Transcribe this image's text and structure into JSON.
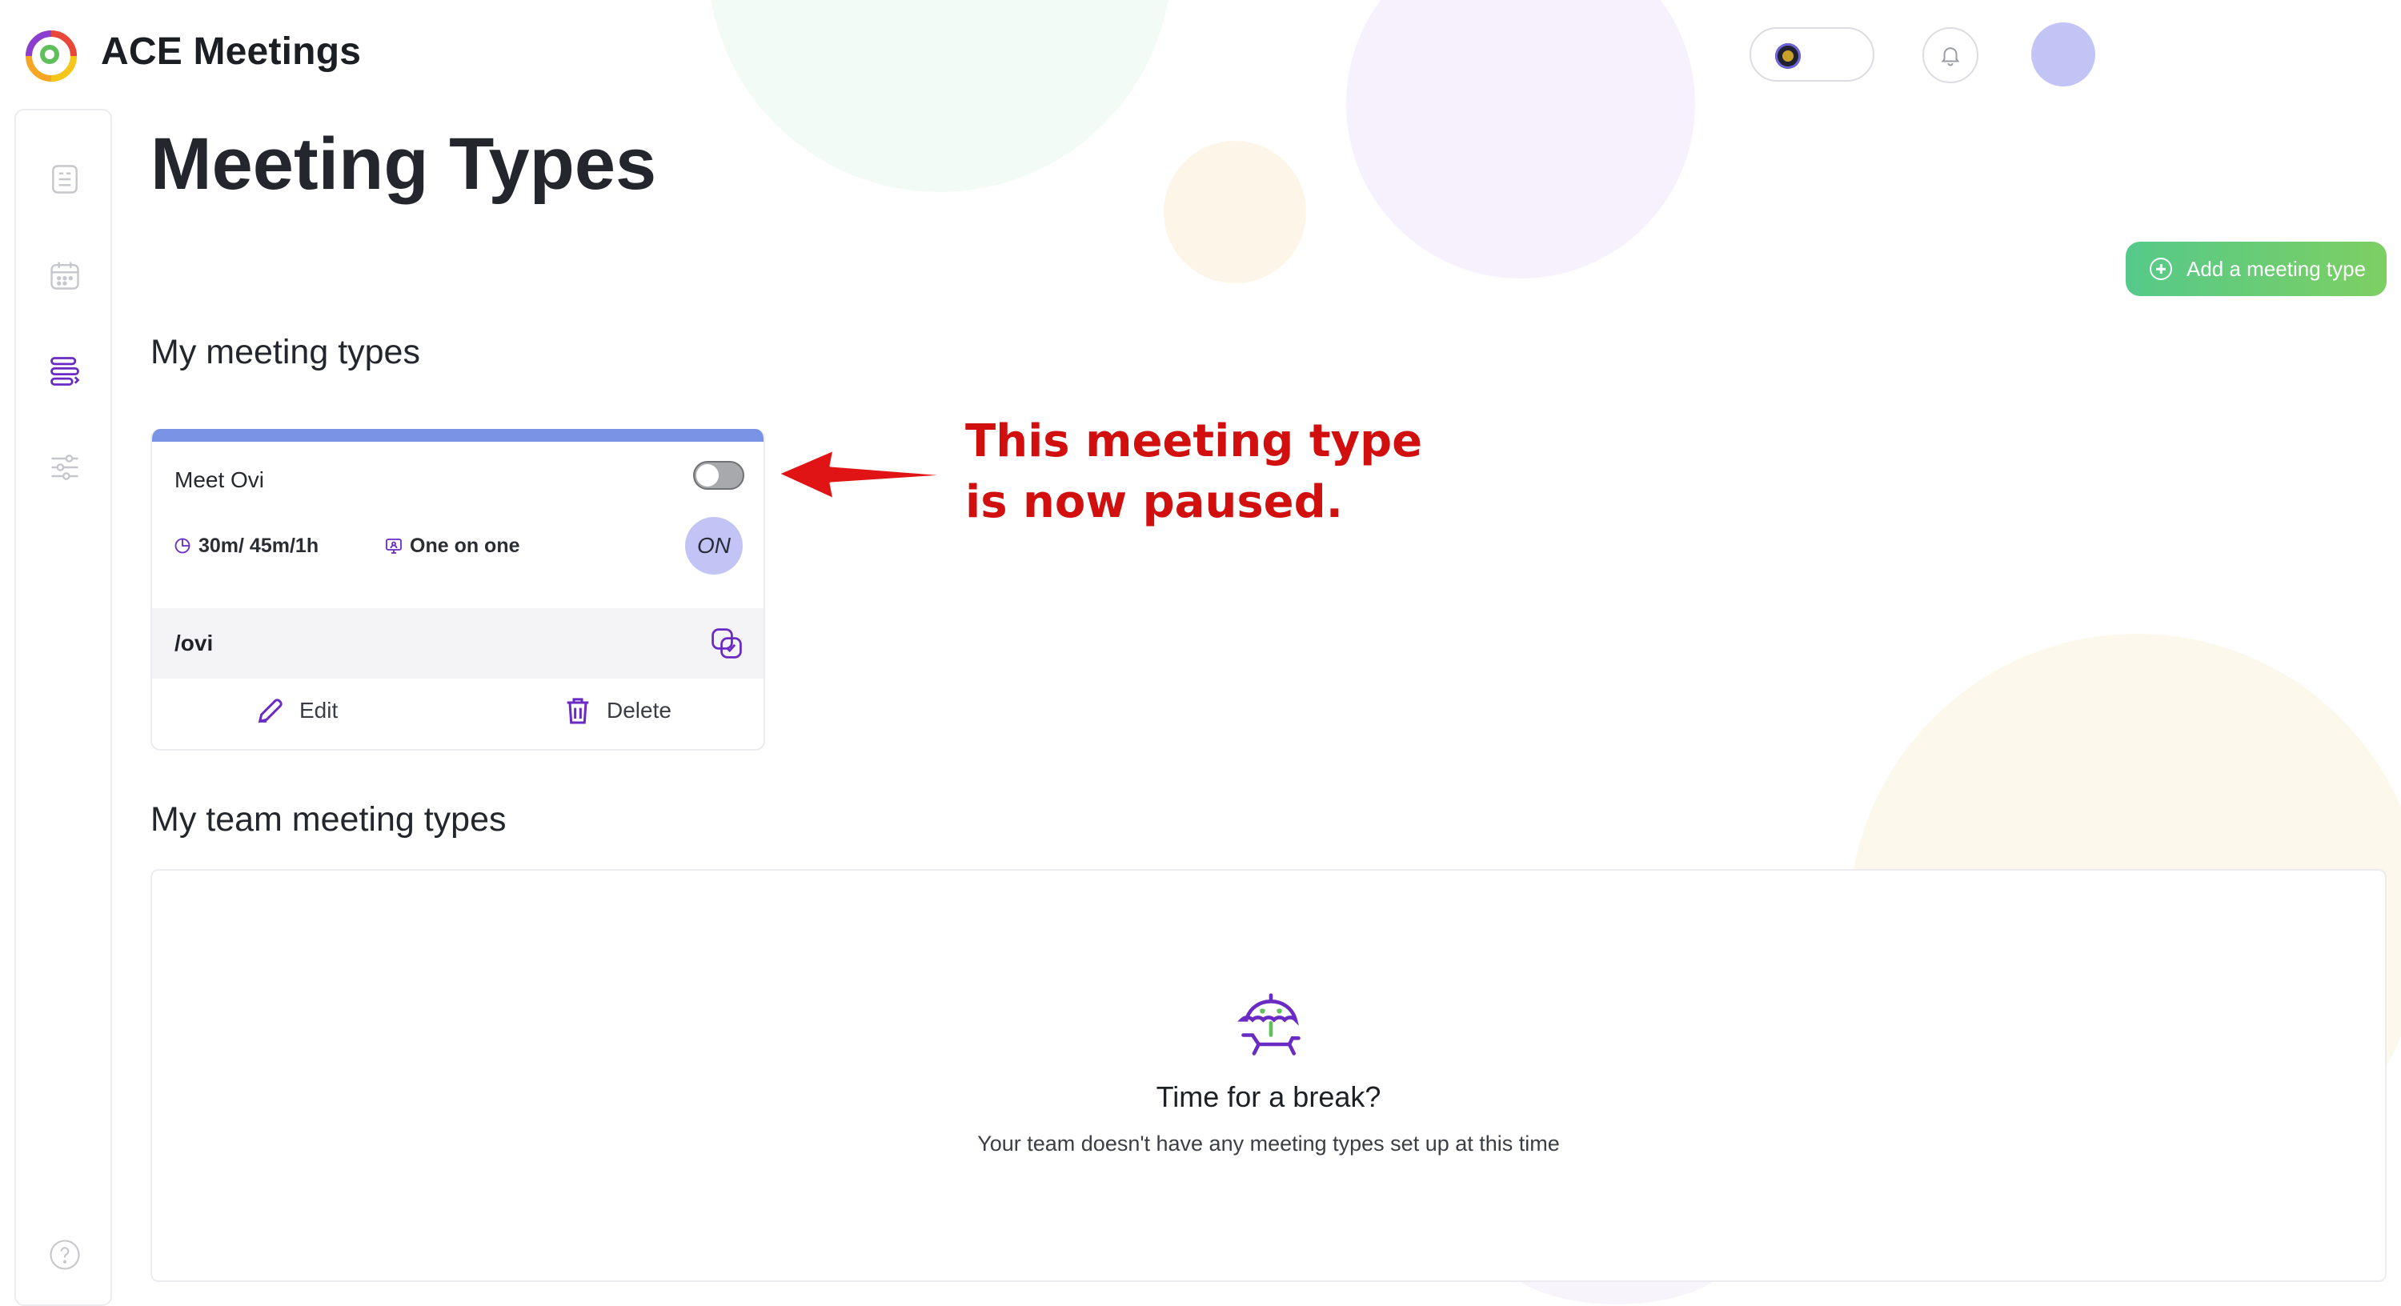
{
  "app": {
    "title": "ACE Meetings"
  },
  "page": {
    "title": "Meeting Types",
    "add_button_label": "Add a meeting type"
  },
  "sections": {
    "mine": "My meeting types",
    "team": "My team meeting types"
  },
  "meeting_card": {
    "name": "Meet Ovi",
    "paused": true,
    "durations": "30m/ 45m/1h",
    "type": "One on one",
    "badge": "ON",
    "slug": "/ovi",
    "edit_label": "Edit",
    "delete_label": "Delete",
    "accent_color": "#7a93e4"
  },
  "team_empty": {
    "title": "Time for a break?",
    "description": "Your team doesn't have any meeting types set up at this time"
  },
  "annotation": {
    "line1": "This meeting type",
    "line2": "is now paused."
  },
  "sidebar": {
    "items": [
      {
        "icon": "list-document-icon",
        "active": false
      },
      {
        "icon": "calendar-icon",
        "active": false
      },
      {
        "icon": "meeting-types-icon",
        "active": true
      },
      {
        "icon": "settings-sliders-icon",
        "active": false
      },
      {
        "icon": "help-icon",
        "active": false
      }
    ]
  },
  "colors": {
    "brand_purple": "#6a2bc4",
    "add_button_green": "#55c98a",
    "annotation_red": "#d20f0f"
  }
}
